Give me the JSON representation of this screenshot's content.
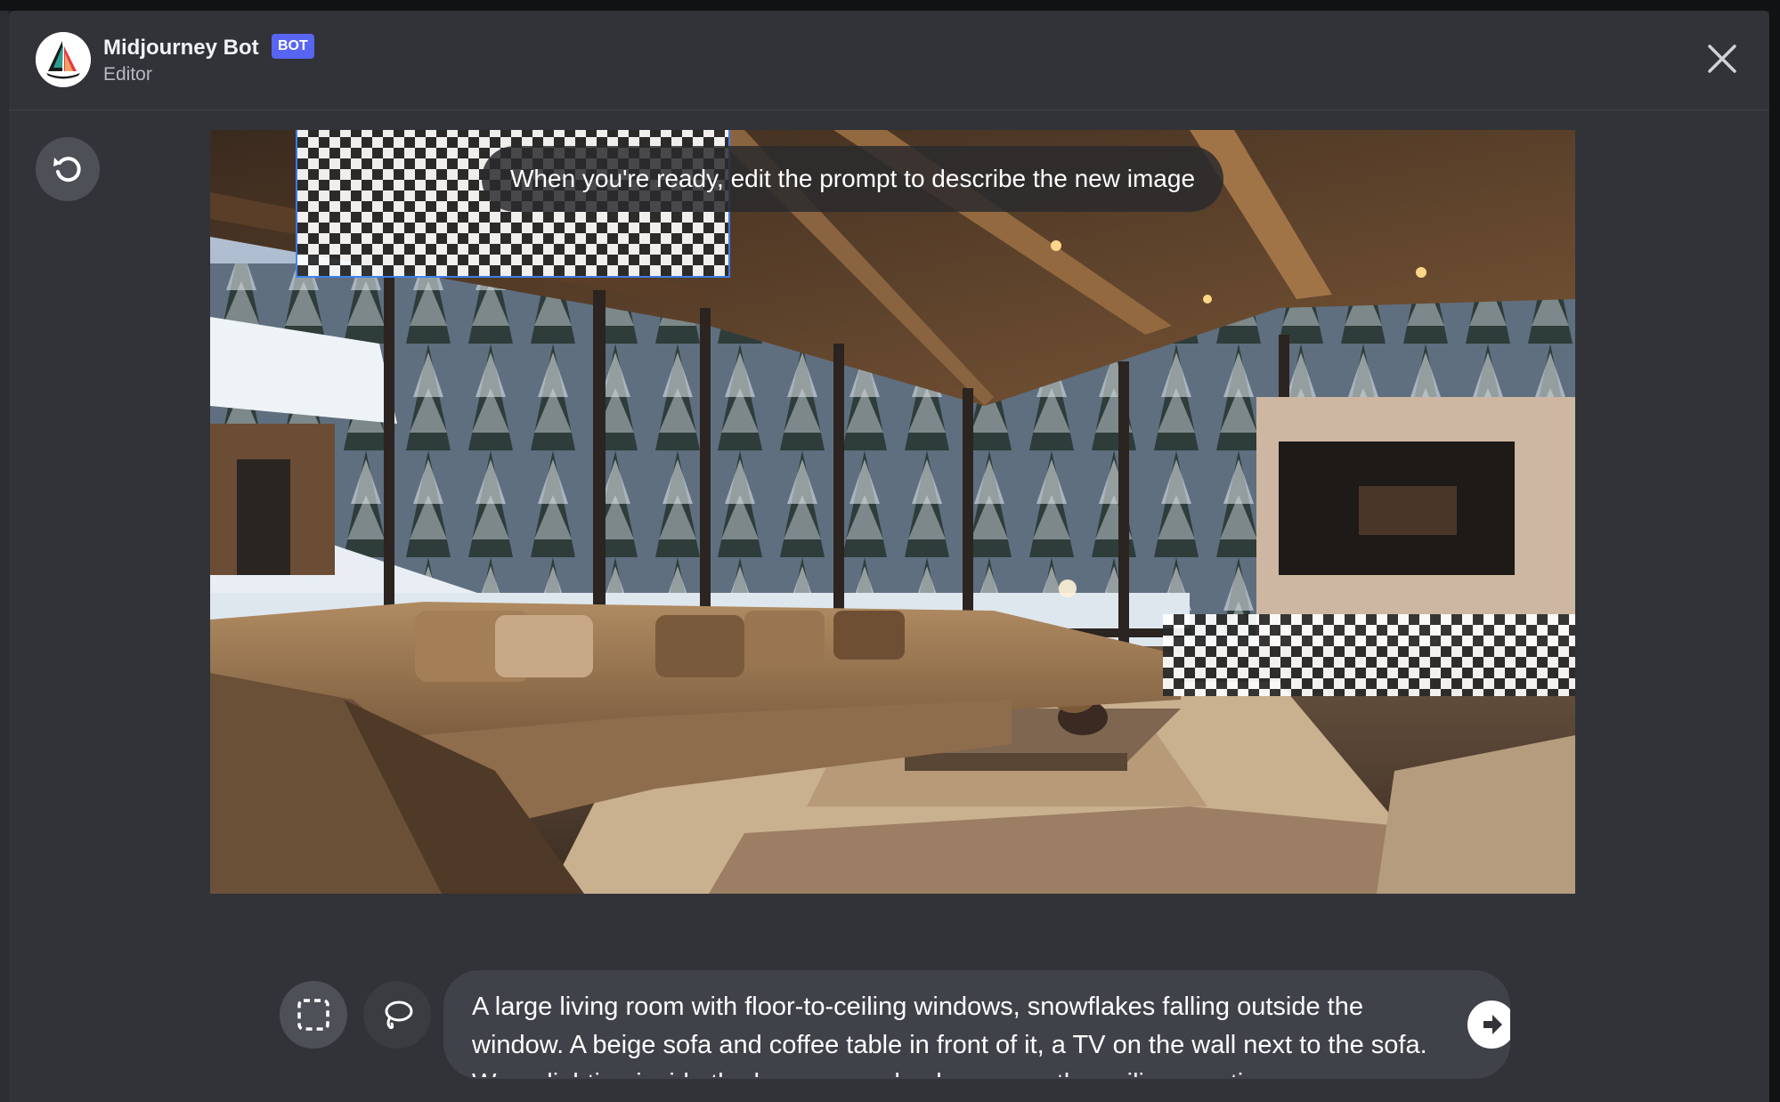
{
  "header": {
    "bot_name": "Midjourney Bot",
    "badge": "BOT",
    "subtitle": "Editor",
    "avatar_icon": "midjourney-sailboat-icon"
  },
  "toolbar": {
    "close_icon": "close-icon",
    "undo_icon": "undo-icon",
    "select_tool_icon": "rectangle-select-icon",
    "lasso_tool_icon": "lasso-icon",
    "send_icon": "arrow-right-icon"
  },
  "canvas": {
    "hint": "When you're ready, edit the prompt to describe the new image",
    "image_description": "Modern chalet living room with floor-to-ceiling windows, snowy pine trees, beige sectional sofa, coffee table, TV on marble wall"
  },
  "prompt": {
    "text": "A large living room with floor-to-ceiling windows, snowflakes falling outside the window. A beige sofa and coffee table in front of it, a TV on the wall next to the sofa. Warm lighting inside the house, wooden beams on the ceiling creating a"
  },
  "colors": {
    "modal_bg": "#313338",
    "accent": "#5865f2",
    "selection_border": "#3b82f6",
    "input_bg": "#404249"
  }
}
